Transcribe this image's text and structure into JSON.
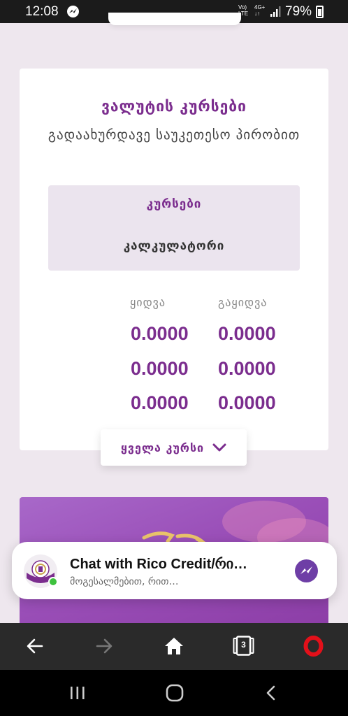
{
  "status_bar": {
    "time": "12:08",
    "volte_line1": "Vo)",
    "volte_line2": "LTE",
    "network_line1": "4G+",
    "network_line2": "↓↑",
    "battery": "79%"
  },
  "rates_card": {
    "title": "ვალუტის კურსები",
    "subtitle": "გადაახურდავე საუკეთესო პირობით",
    "tab_rates": "კურსები",
    "tab_calculator": "კალკულატორი",
    "col_buy": "ყიდვა",
    "col_sell": "გაყიდვა",
    "rows": [
      {
        "buy": "0.0000",
        "sell": "0.0000"
      },
      {
        "buy": "0.0000",
        "sell": "0.0000"
      },
      {
        "buy": "0.0000",
        "sell": "0.0000"
      }
    ],
    "all_rates_label": "ყველა კურსი"
  },
  "chat": {
    "title": "Chat with Rico Credit/რი…",
    "preview": "მოგესალმებით, რით…"
  },
  "browser": {
    "tab_count": "3"
  },
  "colors": {
    "accent": "#7b2d8e",
    "background": "#eee7ee",
    "messenger": "#6e3ea6",
    "opera_red": "#e3101a",
    "online": "#3ec23e"
  }
}
